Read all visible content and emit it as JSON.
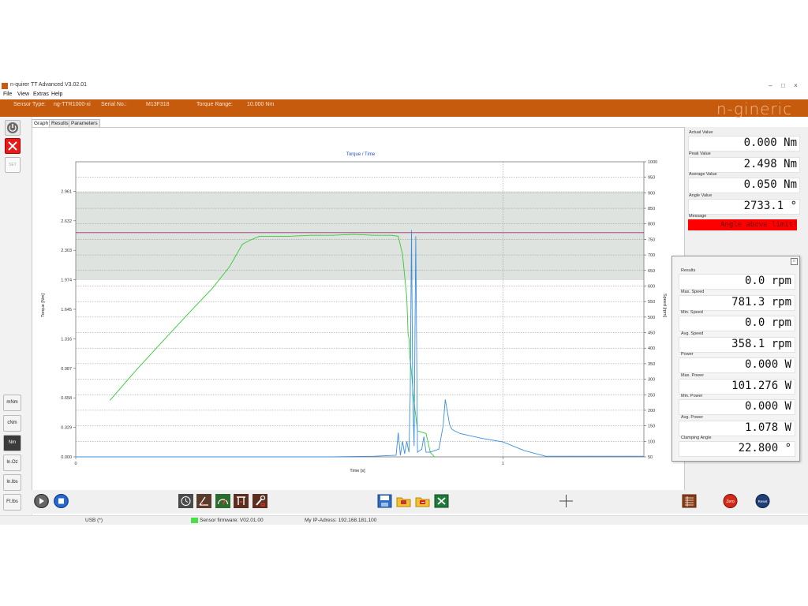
{
  "window": {
    "title": "n-quirer TT Advanced V3.02.01",
    "menu": [
      "File",
      "View",
      "Extras",
      "Help"
    ]
  },
  "sensor_bar": {
    "sensor_type_label": "Sensor Type:",
    "sensor_type_value": "ng-TTR1000-xi",
    "serial_label": "Serial No.:",
    "serial_value": "M13F318",
    "torque_range_label": "Torque Range:",
    "torque_range_value": "10.000 Nm",
    "brand": "n-gineric"
  },
  "left_toolbar": {
    "set_label": "SET",
    "units": [
      "mNm",
      "cNm",
      "Nm",
      "In.Oz",
      "In.lbs",
      "Ft.lbs"
    ],
    "active_unit": "Nm"
  },
  "tabs": [
    "Graph",
    "Results",
    "Parameters"
  ],
  "active_tab": "Graph",
  "right_panel": {
    "actual_label": "Actual Value",
    "actual_value": "0.000 Nm",
    "peak_label": "Peak Value",
    "peak_value": "2.498 Nm",
    "average_label": "Average Value",
    "average_value": "0.050 Nm",
    "angle_label": "Angle Value",
    "angle_value": "2733.1 °",
    "message_label": "Message",
    "message_value": "Angle above limit!"
  },
  "results_window": {
    "items": [
      {
        "label": "Results",
        "value": "0.0 rpm"
      },
      {
        "label": "Max. Speed",
        "value": "781.3 rpm"
      },
      {
        "label": "Min. Speed",
        "value": "0.0 rpm"
      },
      {
        "label": "Avg. Speed",
        "value": "358.1 rpm"
      },
      {
        "label": "Power",
        "value": "0.000 W"
      },
      {
        "label": "Max. Power",
        "value": "101.276 W"
      },
      {
        "label": "Min. Power",
        "value": "0.000 W"
      },
      {
        "label": "Avg. Power",
        "value": "1.078 W"
      },
      {
        "label": "Clamping Angle",
        "value": "22.800 °"
      }
    ]
  },
  "status_bar": {
    "connection": "USB (*)",
    "firmware": "Sensor firmware: V02.01.00",
    "ip": "My IP-Adress: 192.168.181.100"
  },
  "colors": {
    "accent": "#c65b0d",
    "torque_line": "#33cc33",
    "speed_line": "#3a8fe0",
    "limit_line": "#a03070",
    "tolerance_band": "#dfe3e0",
    "message_bg": "#ff0000"
  },
  "chart_data": {
    "type": "line",
    "title": "Torque / Time",
    "xlabel": "Time [s]",
    "ylabel": "Torque [Nm]",
    "y2label": "Speed [rpm]",
    "xlim": [
      0,
      1.33
    ],
    "x_ticks": [
      "0",
      "1"
    ],
    "ylim": [
      0,
      3.29
    ],
    "y_ticks": [
      "0.000",
      "0.329",
      "0.658",
      "0.987",
      "1.316",
      "1.645",
      "1.974",
      "2.303",
      "2.632",
      "2.961"
    ],
    "y2lim": [
      50,
      1000
    ],
    "y2_ticks": [
      "50",
      "100",
      "150",
      "200",
      "250",
      "300",
      "350",
      "400",
      "450",
      "500",
      "550",
      "600",
      "650",
      "700",
      "750",
      "800",
      "850",
      "900",
      "950",
      "1000"
    ],
    "tolerance_band": [
      1.97,
      2.96
    ],
    "limit_line": 2.5,
    "grid": true,
    "series": [
      {
        "axis": "left",
        "x": [
          0.08,
          0.14,
          0.2,
          0.26,
          0.32,
          0.36,
          0.39,
          0.41,
          0.43,
          0.45,
          0.5,
          0.55,
          0.6,
          0.65,
          0.7,
          0.74,
          0.755,
          0.765,
          0.775,
          0.778,
          0.78,
          0.782,
          0.785,
          0.79,
          0.8,
          0.82,
          0.825,
          0.83,
          0.84,
          0.843
        ],
        "values": [
          0.63,
          0.96,
          1.27,
          1.58,
          1.88,
          2.12,
          2.37,
          2.42,
          2.46,
          2.46,
          2.46,
          2.47,
          2.47,
          2.48,
          2.47,
          2.47,
          2.46,
          2.26,
          1.78,
          1.37,
          1.32,
          1.12,
          0.99,
          0.7,
          0.29,
          0.26,
          0.16,
          0.05,
          0.0,
          0.0
        ]
      },
      {
        "axis": "right",
        "x": [
          0.0,
          0.2,
          0.4,
          0.6,
          0.7,
          0.75,
          0.755,
          0.76,
          0.765,
          0.77,
          0.775,
          0.78,
          0.783,
          0.786,
          0.789,
          0.792,
          0.796,
          0.8,
          0.8,
          0.805,
          0.81,
          0.815,
          0.82,
          0.83,
          0.85,
          0.86,
          0.865,
          0.875,
          0.88,
          0.885,
          0.9,
          0.95,
          1.0,
          1.05,
          1.1,
          1.33
        ],
        "values": [
          50,
          50,
          50,
          50,
          52,
          55,
          128,
          55,
          100,
          60,
          100,
          65,
          250,
          780,
          250,
          85,
          760,
          66,
          65,
          70,
          75,
          115,
          65,
          65,
          75,
          150,
          235,
          155,
          140,
          135,
          125,
          110,
          98,
          70,
          52,
          52
        ]
      }
    ]
  }
}
